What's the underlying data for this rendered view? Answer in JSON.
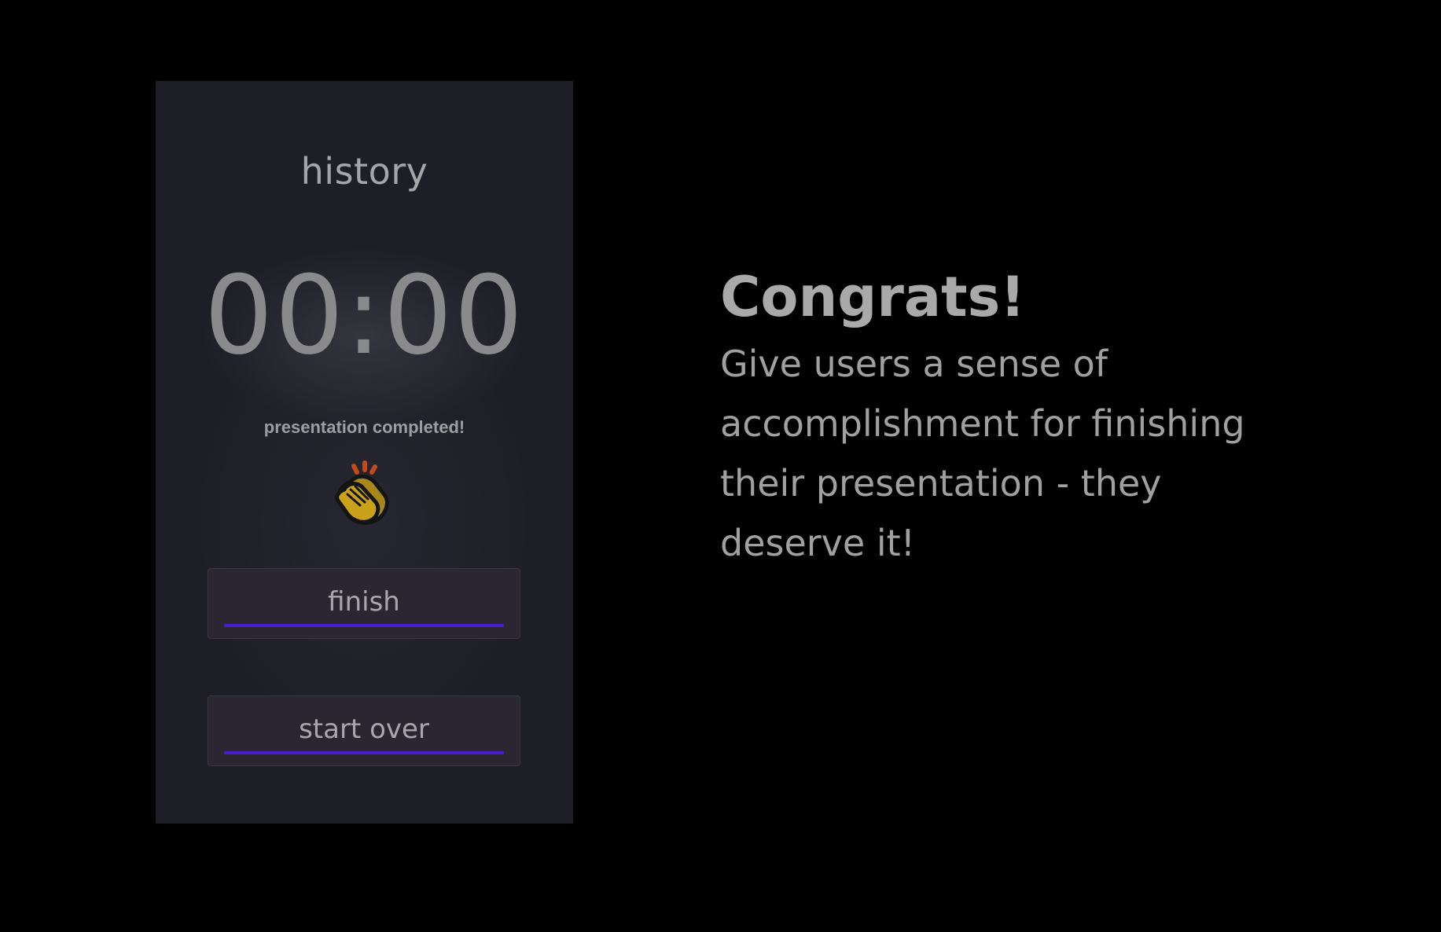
{
  "phone": {
    "title": "history",
    "timer": "00:00",
    "status": "presentation completed!",
    "icon": "clapping-hands-icon",
    "buttons": {
      "finish": "finish",
      "start_over": "start over"
    }
  },
  "copy": {
    "heading": "Congrats!",
    "body": "Give users a sense of accomplishment for finishing their presentation - they deserve it!"
  },
  "colors": {
    "background": "#000000",
    "phone_background": "#1e1e26",
    "button_background": "#2a2732",
    "accent_underline": "#4a1fd4",
    "clap_fill": "#c9a21a"
  }
}
